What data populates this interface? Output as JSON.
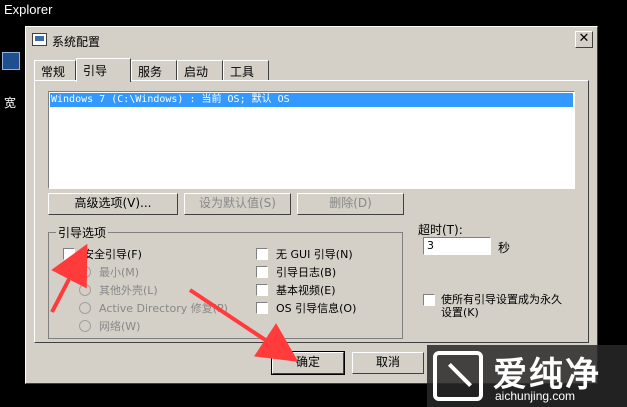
{
  "background": {
    "window_title": "Explorer",
    "desktop_icon_label": "宽"
  },
  "dialog": {
    "title": "系统配置",
    "close_label": "✕",
    "tabs": [
      {
        "label": "常规"
      },
      {
        "label": "引导"
      },
      {
        "label": "服务"
      },
      {
        "label": "启动"
      },
      {
        "label": "工具"
      }
    ],
    "active_tab": "引导",
    "os_list": [
      "Windows 7 (C:\\Windows) : 当前 OS; 默认 OS"
    ],
    "buttons": {
      "advanced": "高级选项(V)...",
      "set_default": "设为默认值(S)",
      "delete": "删除(D)",
      "ok": "确定",
      "cancel": "取消"
    },
    "boot_options": {
      "legend": "引导选项",
      "safe_boot": "安全引导(F)",
      "radios": [
        {
          "label": "最小(M)",
          "selected": true
        },
        {
          "label": "其他外壳(L)",
          "selected": false
        },
        {
          "label": "Active Directory 修复(P)",
          "selected": false
        },
        {
          "label": "网络(W)",
          "selected": false
        }
      ],
      "right_checks": [
        {
          "label": "无 GUI 引导(N)"
        },
        {
          "label": "引导日志(B)"
        },
        {
          "label": "基本视频(E)"
        },
        {
          "label": "OS 引导信息(O)"
        }
      ]
    },
    "timeout": {
      "label": "超时(T):",
      "value": "3",
      "unit": "秒"
    },
    "permanent_label_line1": "使所有引导设置成为永久",
    "permanent_label_line2": "设置(K)"
  },
  "watermark": {
    "title": "爱纯净",
    "url": "aichunjing.com"
  },
  "colors": {
    "dialog_bg": "#d4d0c8",
    "selection": "#3399ff",
    "arrow": "#ff3b3b"
  }
}
